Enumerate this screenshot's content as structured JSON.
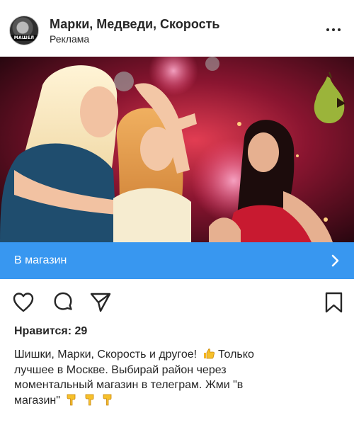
{
  "post": {
    "account_name": "Марки, Медведи, Скорость",
    "sponsored_label": "Реклама",
    "avatar_text": "МАШЕЛ"
  },
  "cta": {
    "label": "В магазин"
  },
  "likes": {
    "text": "Нравится: 29"
  },
  "caption": {
    "line1": "Шишки, Марки, Скорость и другое!",
    "line1b": "Только",
    "line2": "лучшее в Москве. Выбирай район через",
    "line3": "моментальный магазин в телеграм. Жми \"в",
    "line4": "магазин\""
  },
  "icons": {
    "more": "more-dots-icon",
    "like": "heart-icon",
    "comment": "comment-icon",
    "share": "send-icon",
    "save": "bookmark-icon",
    "cta_arrow": "chevron-right-icon"
  },
  "colors": {
    "cta_background": "#3897f0",
    "text": "#262626"
  }
}
